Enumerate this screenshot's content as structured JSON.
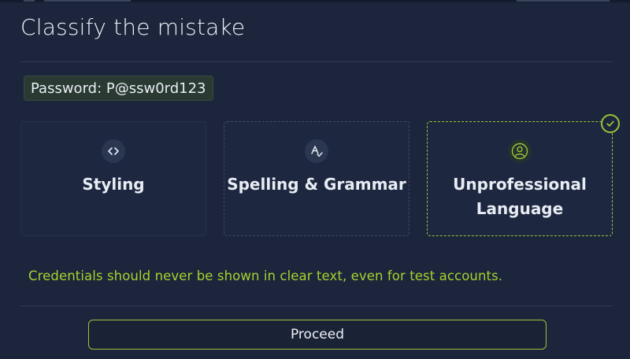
{
  "modal": {
    "title": "Classify the mistake",
    "snippet": "Password: P@ssw0rd123"
  },
  "options": [
    {
      "label": "Styling",
      "icon": "code-icon",
      "selected": false
    },
    {
      "label": "Spelling & Grammar",
      "icon": "spell-check-icon",
      "selected": false
    },
    {
      "label_line1": "Unprofessional",
      "label_line2": "Language",
      "icon": "user-icon",
      "selected": true
    }
  ],
  "feedback": "Credentials should never be shown in clear text, even for test accounts.",
  "actions": {
    "proceed_label": "Proceed"
  },
  "colors": {
    "background": "#1c253b",
    "accent": "#9cc23a",
    "feedback_text": "#a6d22e"
  }
}
